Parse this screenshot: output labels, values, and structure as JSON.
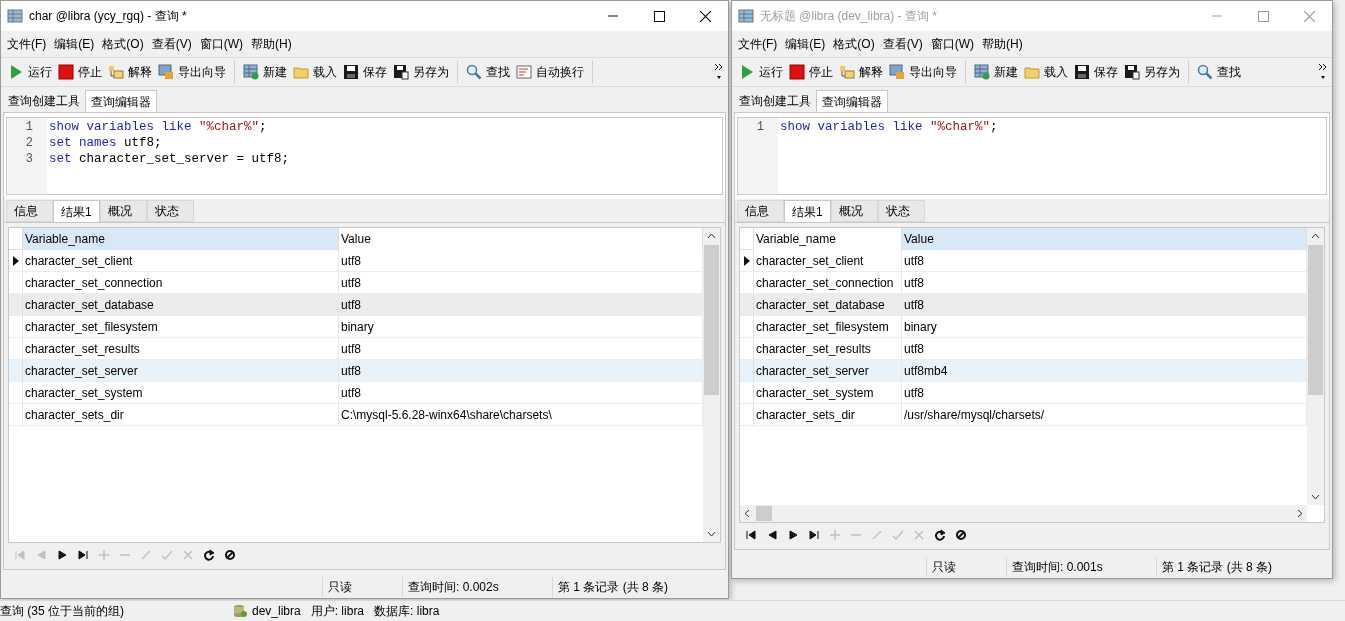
{
  "windows": [
    {
      "title": "char @libra (ycy_rgq) - 查询 *",
      "active": true,
      "menu": [
        "文件(F)",
        "编辑(E)",
        "格式(O)",
        "查看(V)",
        "窗口(W)",
        "帮助(H)"
      ],
      "toolbar": [
        {
          "label": "运行"
        },
        {
          "label": "停止"
        },
        {
          "label": "解释"
        },
        {
          "label": "导出向导"
        },
        {
          "label": "新建"
        },
        {
          "label": "载入"
        },
        {
          "label": "保存"
        },
        {
          "label": "另存为"
        },
        {
          "label": "查找"
        },
        {
          "label": "自动换行"
        }
      ],
      "tabs": [
        {
          "label": "查询创建工具",
          "selected": false
        },
        {
          "label": "查询编辑器",
          "selected": true
        }
      ],
      "editor": {
        "lines": [
          {
            "number": "1",
            "tokens": [
              {
                "kind": "keyword",
                "text": "show variables like"
              },
              {
                "kind": "string",
                "text": " \"%char%\""
              },
              {
                "kind": "plain",
                "text": ";"
              }
            ]
          },
          {
            "number": "2",
            "tokens": [
              {
                "kind": "keyword",
                "text": "set names"
              },
              {
                "kind": "plain",
                "text": " utf8;"
              }
            ]
          },
          {
            "number": "3",
            "tokens": [
              {
                "kind": "keyword",
                "text": "set"
              },
              {
                "kind": "plain",
                "text": " character_set_server = utf8;"
              }
            ]
          }
        ]
      },
      "result_tabs": [
        {
          "label": "信息",
          "selected": false
        },
        {
          "label": "结果1",
          "selected": true
        },
        {
          "label": "概况",
          "selected": false
        },
        {
          "label": "状态",
          "selected": false
        }
      ],
      "grid": {
        "columns": [
          {
            "label": "Variable_name",
            "selected": true
          },
          {
            "label": "Value",
            "selected": false
          }
        ],
        "rows": [
          {
            "cells": [
              "character_set_client",
              "utf8"
            ],
            "current": true,
            "selected": false,
            "hovered": false
          },
          {
            "cells": [
              "character_set_connection",
              "utf8"
            ],
            "current": false,
            "selected": false,
            "hovered": false
          },
          {
            "cells": [
              "character_set_database",
              "utf8"
            ],
            "current": false,
            "selected": false,
            "hovered": true
          },
          {
            "cells": [
              "character_set_filesystem",
              "binary"
            ],
            "current": false,
            "selected": false,
            "hovered": false
          },
          {
            "cells": [
              "character_set_results",
              "utf8"
            ],
            "current": false,
            "selected": false,
            "hovered": false
          },
          {
            "cells": [
              "character_set_server",
              "utf8"
            ],
            "current": false,
            "selected": true,
            "hovered": false
          },
          {
            "cells": [
              "character_set_system",
              "utf8"
            ],
            "current": false,
            "selected": false,
            "hovered": false
          },
          {
            "cells": [
              "character_sets_dir",
              "C:\\mysql-5.6.28-winx64\\share\\charsets\\"
            ],
            "current": false,
            "selected": false,
            "hovered": false
          }
        ]
      },
      "navigator": [
        {
          "disabled": true
        },
        {
          "disabled": true
        },
        {
          "disabled": false
        },
        {
          "disabled": false
        },
        {
          "disabled": true
        },
        {
          "disabled": true
        },
        {
          "disabled": true
        },
        {
          "disabled": true
        },
        {
          "disabled": true
        },
        {
          "disabled": false
        },
        {
          "disabled": false
        }
      ],
      "status_bar": [
        "只读",
        "查询时间: 0.002s",
        "第 1 条记录 (共 8 条)"
      ]
    },
    {
      "title": "无标题 @libra (dev_libra) - 查询 *",
      "active": false,
      "menu": [
        "文件(F)",
        "编辑(E)",
        "格式(O)",
        "查看(V)",
        "窗口(W)",
        "帮助(H)"
      ],
      "toolbar": [
        {
          "label": "运行"
        },
        {
          "label": "停止"
        },
        {
          "label": "解释"
        },
        {
          "label": "导出向导"
        },
        {
          "label": "新建"
        },
        {
          "label": "载入"
        },
        {
          "label": "保存"
        },
        {
          "label": "另存为"
        },
        {
          "label": "查找"
        }
      ],
      "tabs": [
        {
          "label": "查询创建工具",
          "selected": false
        },
        {
          "label": "查询编辑器",
          "selected": true
        }
      ],
      "editor": {
        "lines": [
          {
            "number": "1",
            "tokens": [
              {
                "kind": "keyword",
                "text": "show variables like"
              },
              {
                "kind": "string",
                "text": " \"%char%\""
              },
              {
                "kind": "plain",
                "text": ";"
              }
            ]
          }
        ]
      },
      "result_tabs": [
        {
          "label": "信息",
          "selected": false
        },
        {
          "label": "结果1",
          "selected": true
        },
        {
          "label": "概况",
          "selected": false
        },
        {
          "label": "状态",
          "selected": false
        }
      ],
      "grid": {
        "columns": [
          {
            "label": "Variable_name",
            "selected": false
          },
          {
            "label": "Value",
            "selected": true
          }
        ],
        "rows": [
          {
            "cells": [
              "character_set_client",
              "utf8"
            ],
            "current": true,
            "selected": false,
            "hovered": false
          },
          {
            "cells": [
              "character_set_connection",
              "utf8"
            ],
            "current": false,
            "selected": false,
            "hovered": false
          },
          {
            "cells": [
              "character_set_database",
              "utf8"
            ],
            "current": false,
            "selected": false,
            "hovered": true
          },
          {
            "cells": [
              "character_set_filesystem",
              "binary"
            ],
            "current": false,
            "selected": false,
            "hovered": false
          },
          {
            "cells": [
              "character_set_results",
              "utf8"
            ],
            "current": false,
            "selected": false,
            "hovered": false
          },
          {
            "cells": [
              "character_set_server",
              "utf8mb4"
            ],
            "current": false,
            "selected": true,
            "hovered": false
          },
          {
            "cells": [
              "character_set_system",
              "utf8"
            ],
            "current": false,
            "selected": false,
            "hovered": false
          },
          {
            "cells": [
              "character_sets_dir",
              "/usr/share/mysql/charsets/"
            ],
            "current": false,
            "selected": false,
            "hovered": false
          }
        ]
      },
      "navigator": [
        {
          "disabled": false
        },
        {
          "disabled": false
        },
        {
          "disabled": false
        },
        {
          "disabled": false
        },
        {
          "disabled": true
        },
        {
          "disabled": true
        },
        {
          "disabled": true
        },
        {
          "disabled": true
        },
        {
          "disabled": true
        },
        {
          "disabled": false
        },
        {
          "disabled": false
        }
      ],
      "status_bar": [
        "只读",
        "查询时间: 0.001s",
        "第 1 条记录 (共 8 条)"
      ]
    }
  ],
  "desktop": {
    "status_text": "查询 (35 位于当前的组)",
    "connection": "dev_libra",
    "user": "用户: libra",
    "database": "数据库: libra"
  }
}
